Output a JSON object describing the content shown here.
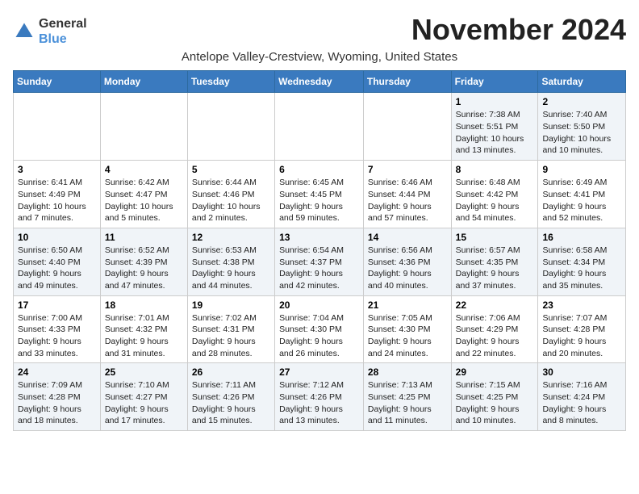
{
  "logo": {
    "general": "General",
    "blue": "Blue"
  },
  "title": "November 2024",
  "subtitle": "Antelope Valley-Crestview, Wyoming, United States",
  "days_of_week": [
    "Sunday",
    "Monday",
    "Tuesday",
    "Wednesday",
    "Thursday",
    "Friday",
    "Saturday"
  ],
  "weeks": [
    [
      {
        "day": "",
        "info": ""
      },
      {
        "day": "",
        "info": ""
      },
      {
        "day": "",
        "info": ""
      },
      {
        "day": "",
        "info": ""
      },
      {
        "day": "",
        "info": ""
      },
      {
        "day": "1",
        "info": "Sunrise: 7:38 AM\nSunset: 5:51 PM\nDaylight: 10 hours and 13 minutes."
      },
      {
        "day": "2",
        "info": "Sunrise: 7:40 AM\nSunset: 5:50 PM\nDaylight: 10 hours and 10 minutes."
      }
    ],
    [
      {
        "day": "3",
        "info": "Sunrise: 6:41 AM\nSunset: 4:49 PM\nDaylight: 10 hours and 7 minutes."
      },
      {
        "day": "4",
        "info": "Sunrise: 6:42 AM\nSunset: 4:47 PM\nDaylight: 10 hours and 5 minutes."
      },
      {
        "day": "5",
        "info": "Sunrise: 6:44 AM\nSunset: 4:46 PM\nDaylight: 10 hours and 2 minutes."
      },
      {
        "day": "6",
        "info": "Sunrise: 6:45 AM\nSunset: 4:45 PM\nDaylight: 9 hours and 59 minutes."
      },
      {
        "day": "7",
        "info": "Sunrise: 6:46 AM\nSunset: 4:44 PM\nDaylight: 9 hours and 57 minutes."
      },
      {
        "day": "8",
        "info": "Sunrise: 6:48 AM\nSunset: 4:42 PM\nDaylight: 9 hours and 54 minutes."
      },
      {
        "day": "9",
        "info": "Sunrise: 6:49 AM\nSunset: 4:41 PM\nDaylight: 9 hours and 52 minutes."
      }
    ],
    [
      {
        "day": "10",
        "info": "Sunrise: 6:50 AM\nSunset: 4:40 PM\nDaylight: 9 hours and 49 minutes."
      },
      {
        "day": "11",
        "info": "Sunrise: 6:52 AM\nSunset: 4:39 PM\nDaylight: 9 hours and 47 minutes."
      },
      {
        "day": "12",
        "info": "Sunrise: 6:53 AM\nSunset: 4:38 PM\nDaylight: 9 hours and 44 minutes."
      },
      {
        "day": "13",
        "info": "Sunrise: 6:54 AM\nSunset: 4:37 PM\nDaylight: 9 hours and 42 minutes."
      },
      {
        "day": "14",
        "info": "Sunrise: 6:56 AM\nSunset: 4:36 PM\nDaylight: 9 hours and 40 minutes."
      },
      {
        "day": "15",
        "info": "Sunrise: 6:57 AM\nSunset: 4:35 PM\nDaylight: 9 hours and 37 minutes."
      },
      {
        "day": "16",
        "info": "Sunrise: 6:58 AM\nSunset: 4:34 PM\nDaylight: 9 hours and 35 minutes."
      }
    ],
    [
      {
        "day": "17",
        "info": "Sunrise: 7:00 AM\nSunset: 4:33 PM\nDaylight: 9 hours and 33 minutes."
      },
      {
        "day": "18",
        "info": "Sunrise: 7:01 AM\nSunset: 4:32 PM\nDaylight: 9 hours and 31 minutes."
      },
      {
        "day": "19",
        "info": "Sunrise: 7:02 AM\nSunset: 4:31 PM\nDaylight: 9 hours and 28 minutes."
      },
      {
        "day": "20",
        "info": "Sunrise: 7:04 AM\nSunset: 4:30 PM\nDaylight: 9 hours and 26 minutes."
      },
      {
        "day": "21",
        "info": "Sunrise: 7:05 AM\nSunset: 4:30 PM\nDaylight: 9 hours and 24 minutes."
      },
      {
        "day": "22",
        "info": "Sunrise: 7:06 AM\nSunset: 4:29 PM\nDaylight: 9 hours and 22 minutes."
      },
      {
        "day": "23",
        "info": "Sunrise: 7:07 AM\nSunset: 4:28 PM\nDaylight: 9 hours and 20 minutes."
      }
    ],
    [
      {
        "day": "24",
        "info": "Sunrise: 7:09 AM\nSunset: 4:28 PM\nDaylight: 9 hours and 18 minutes."
      },
      {
        "day": "25",
        "info": "Sunrise: 7:10 AM\nSunset: 4:27 PM\nDaylight: 9 hours and 17 minutes."
      },
      {
        "day": "26",
        "info": "Sunrise: 7:11 AM\nSunset: 4:26 PM\nDaylight: 9 hours and 15 minutes."
      },
      {
        "day": "27",
        "info": "Sunrise: 7:12 AM\nSunset: 4:26 PM\nDaylight: 9 hours and 13 minutes."
      },
      {
        "day": "28",
        "info": "Sunrise: 7:13 AM\nSunset: 4:25 PM\nDaylight: 9 hours and 11 minutes."
      },
      {
        "day": "29",
        "info": "Sunrise: 7:15 AM\nSunset: 4:25 PM\nDaylight: 9 hours and 10 minutes."
      },
      {
        "day": "30",
        "info": "Sunrise: 7:16 AM\nSunset: 4:24 PM\nDaylight: 9 hours and 8 minutes."
      }
    ]
  ]
}
